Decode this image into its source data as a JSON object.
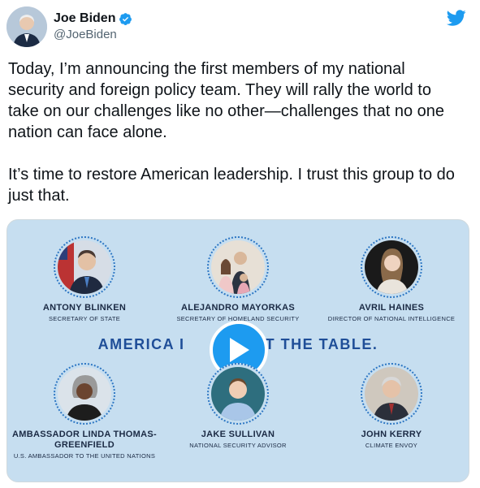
{
  "author": {
    "display_name": "Joe Biden",
    "handle": "@JoeBiden",
    "verified": true,
    "avatar_icon": "user-avatar"
  },
  "header": {
    "platform_icon": "twitter-bird-icon",
    "accent": "#1d9bf0"
  },
  "tweet": {
    "text": "Today, I’m announcing the first members of my national security and foreign policy team. They will rally the world to take on our challenges like no other—challenges that no one nation can face alone.\n\nIt’s time to restore American leadership. I trust this group to do just that."
  },
  "media": {
    "headline_left": "AMERICA I",
    "headline_right": "AT THE TABLE.",
    "play_icon": "play-icon",
    "people": [
      {
        "name": "ANTONY BLINKEN",
        "title": "SECRETARY OF STATE"
      },
      {
        "name": "ALEJANDRO MAYORKAS",
        "title": "SECRETARY OF HOMELAND SECURITY"
      },
      {
        "name": "AVRIL HAINES",
        "title": "DIRECTOR OF NATIONAL INTELLIGENCE"
      },
      {
        "name": "AMBASSADOR LINDA THOMAS-GREENFIELD",
        "title": "U.S. AMBASSADOR TO THE UNITED NATIONS"
      },
      {
        "name": "JAKE SULLIVAN",
        "title": "NATIONAL SECURITY ADVISOR"
      },
      {
        "name": "JOHN KERRY",
        "title": "CLIMATE ENVOY"
      }
    ]
  }
}
